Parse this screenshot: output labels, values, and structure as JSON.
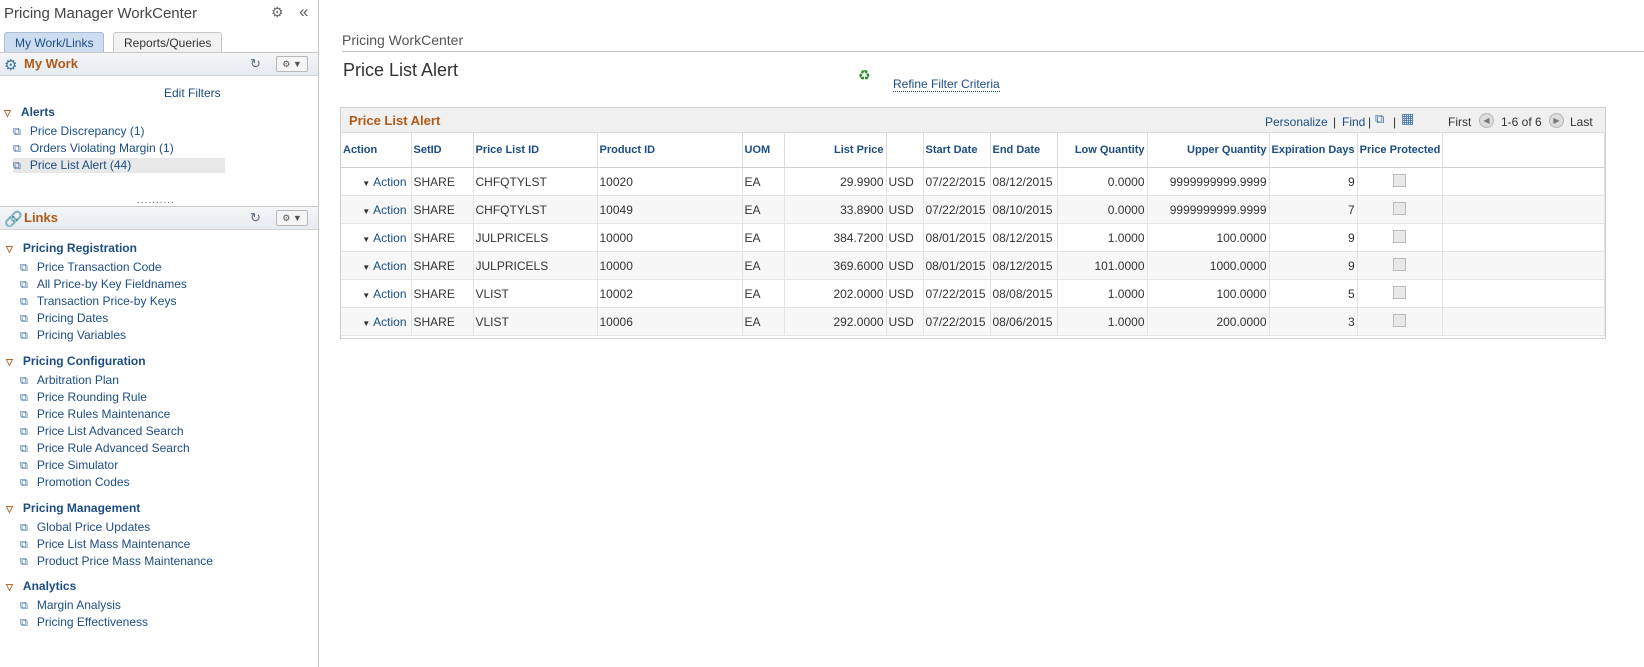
{
  "workcenter": {
    "title": "Pricing Manager WorkCenter",
    "tabs": [
      "My Work/Links",
      "Reports/Queries"
    ]
  },
  "my_work": {
    "title": "My Work",
    "edit_filters": "Edit Filters",
    "alerts_group": "Alerts",
    "alerts": [
      "Price Discrepancy (1)",
      "Orders Violating Margin (1)",
      "Price List Alert (44)"
    ]
  },
  "links": {
    "title": "Links",
    "groups": [
      {
        "title": "Pricing Registration",
        "items": [
          "Price Transaction Code",
          "All Price-by Key Fieldnames",
          "Transaction Price-by Keys",
          "Pricing Dates",
          "Pricing Variables"
        ]
      },
      {
        "title": "Pricing Configuration",
        "items": [
          "Arbitration Plan",
          "Price Rounding Rule",
          "Price Rules Maintenance",
          "Price List Advanced Search",
          "Price Rule Advanced Search",
          "Price Simulator",
          "Promotion Codes"
        ]
      },
      {
        "title": "Pricing Management",
        "items": [
          "Global Price Updates",
          "Price List Mass Maintenance",
          "Product Price Mass Maintenance"
        ]
      },
      {
        "title": "Analytics",
        "items": [
          "Margin Analysis",
          "Pricing Effectiveness"
        ]
      }
    ]
  },
  "main": {
    "breadcrumb": "Pricing WorkCenter",
    "page_title": "Price List Alert",
    "refine_link": "Refine Filter Criteria"
  },
  "grid": {
    "title": "Price List Alert",
    "personalize": "Personalize",
    "find": "Find",
    "first": "First",
    "range": "1-6 of 6",
    "last": "Last",
    "columns": [
      "Action",
      "SetID",
      "Price List ID",
      "Product ID",
      "UOM",
      "List Price",
      "",
      "Start Date",
      "End Date",
      "Low Quantity",
      "Upper Quantity",
      "Expiration Days",
      "Price Protected"
    ],
    "rows": [
      {
        "action": "Action",
        "setid": "SHARE",
        "price_list_id": "CHFQTYLST",
        "product_id": "10020",
        "uom": "EA",
        "list_price": "29.9900",
        "currency": "USD",
        "start_date": "07/22/2015",
        "end_date": "08/12/2015",
        "low_qty": "0.0000",
        "upper_qty": "9999999999.9999",
        "exp_days": "9"
      },
      {
        "action": "Action",
        "setid": "SHARE",
        "price_list_id": "CHFQTYLST",
        "product_id": "10049",
        "uom": "EA",
        "list_price": "33.8900",
        "currency": "USD",
        "start_date": "07/22/2015",
        "end_date": "08/10/2015",
        "low_qty": "0.0000",
        "upper_qty": "9999999999.9999",
        "exp_days": "7"
      },
      {
        "action": "Action",
        "setid": "SHARE",
        "price_list_id": "JULPRICELS",
        "product_id": "10000",
        "uom": "EA",
        "list_price": "384.7200",
        "currency": "USD",
        "start_date": "08/01/2015",
        "end_date": "08/12/2015",
        "low_qty": "1.0000",
        "upper_qty": "100.0000",
        "exp_days": "9"
      },
      {
        "action": "Action",
        "setid": "SHARE",
        "price_list_id": "JULPRICELS",
        "product_id": "10000",
        "uom": "EA",
        "list_price": "369.6000",
        "currency": "USD",
        "start_date": "08/01/2015",
        "end_date": "08/12/2015",
        "low_qty": "101.0000",
        "upper_qty": "1000.0000",
        "exp_days": "9"
      },
      {
        "action": "Action",
        "setid": "SHARE",
        "price_list_id": "VLIST",
        "product_id": "10002",
        "uom": "EA",
        "list_price": "202.0000",
        "currency": "USD",
        "start_date": "07/22/2015",
        "end_date": "08/08/2015",
        "low_qty": "1.0000",
        "upper_qty": "100.0000",
        "exp_days": "5"
      },
      {
        "action": "Action",
        "setid": "SHARE",
        "price_list_id": "VLIST",
        "product_id": "10006",
        "uom": "EA",
        "list_price": "292.0000",
        "currency": "USD",
        "start_date": "07/22/2015",
        "end_date": "08/06/2015",
        "low_qty": "1.0000",
        "upper_qty": "200.0000",
        "exp_days": "3"
      }
    ]
  },
  "icons": {
    "settings": "gear-icon",
    "collapse": "double-chevron-left-icon",
    "refresh": "refresh-icon",
    "link": "link-icon",
    "zoom": "zoom-grid-icon",
    "download": "download-spreadsheet-icon"
  },
  "colors": {
    "accent_orange": "#b05a17",
    "link_blue": "#1c4d84",
    "refresh_green": "#2e8b2e"
  }
}
